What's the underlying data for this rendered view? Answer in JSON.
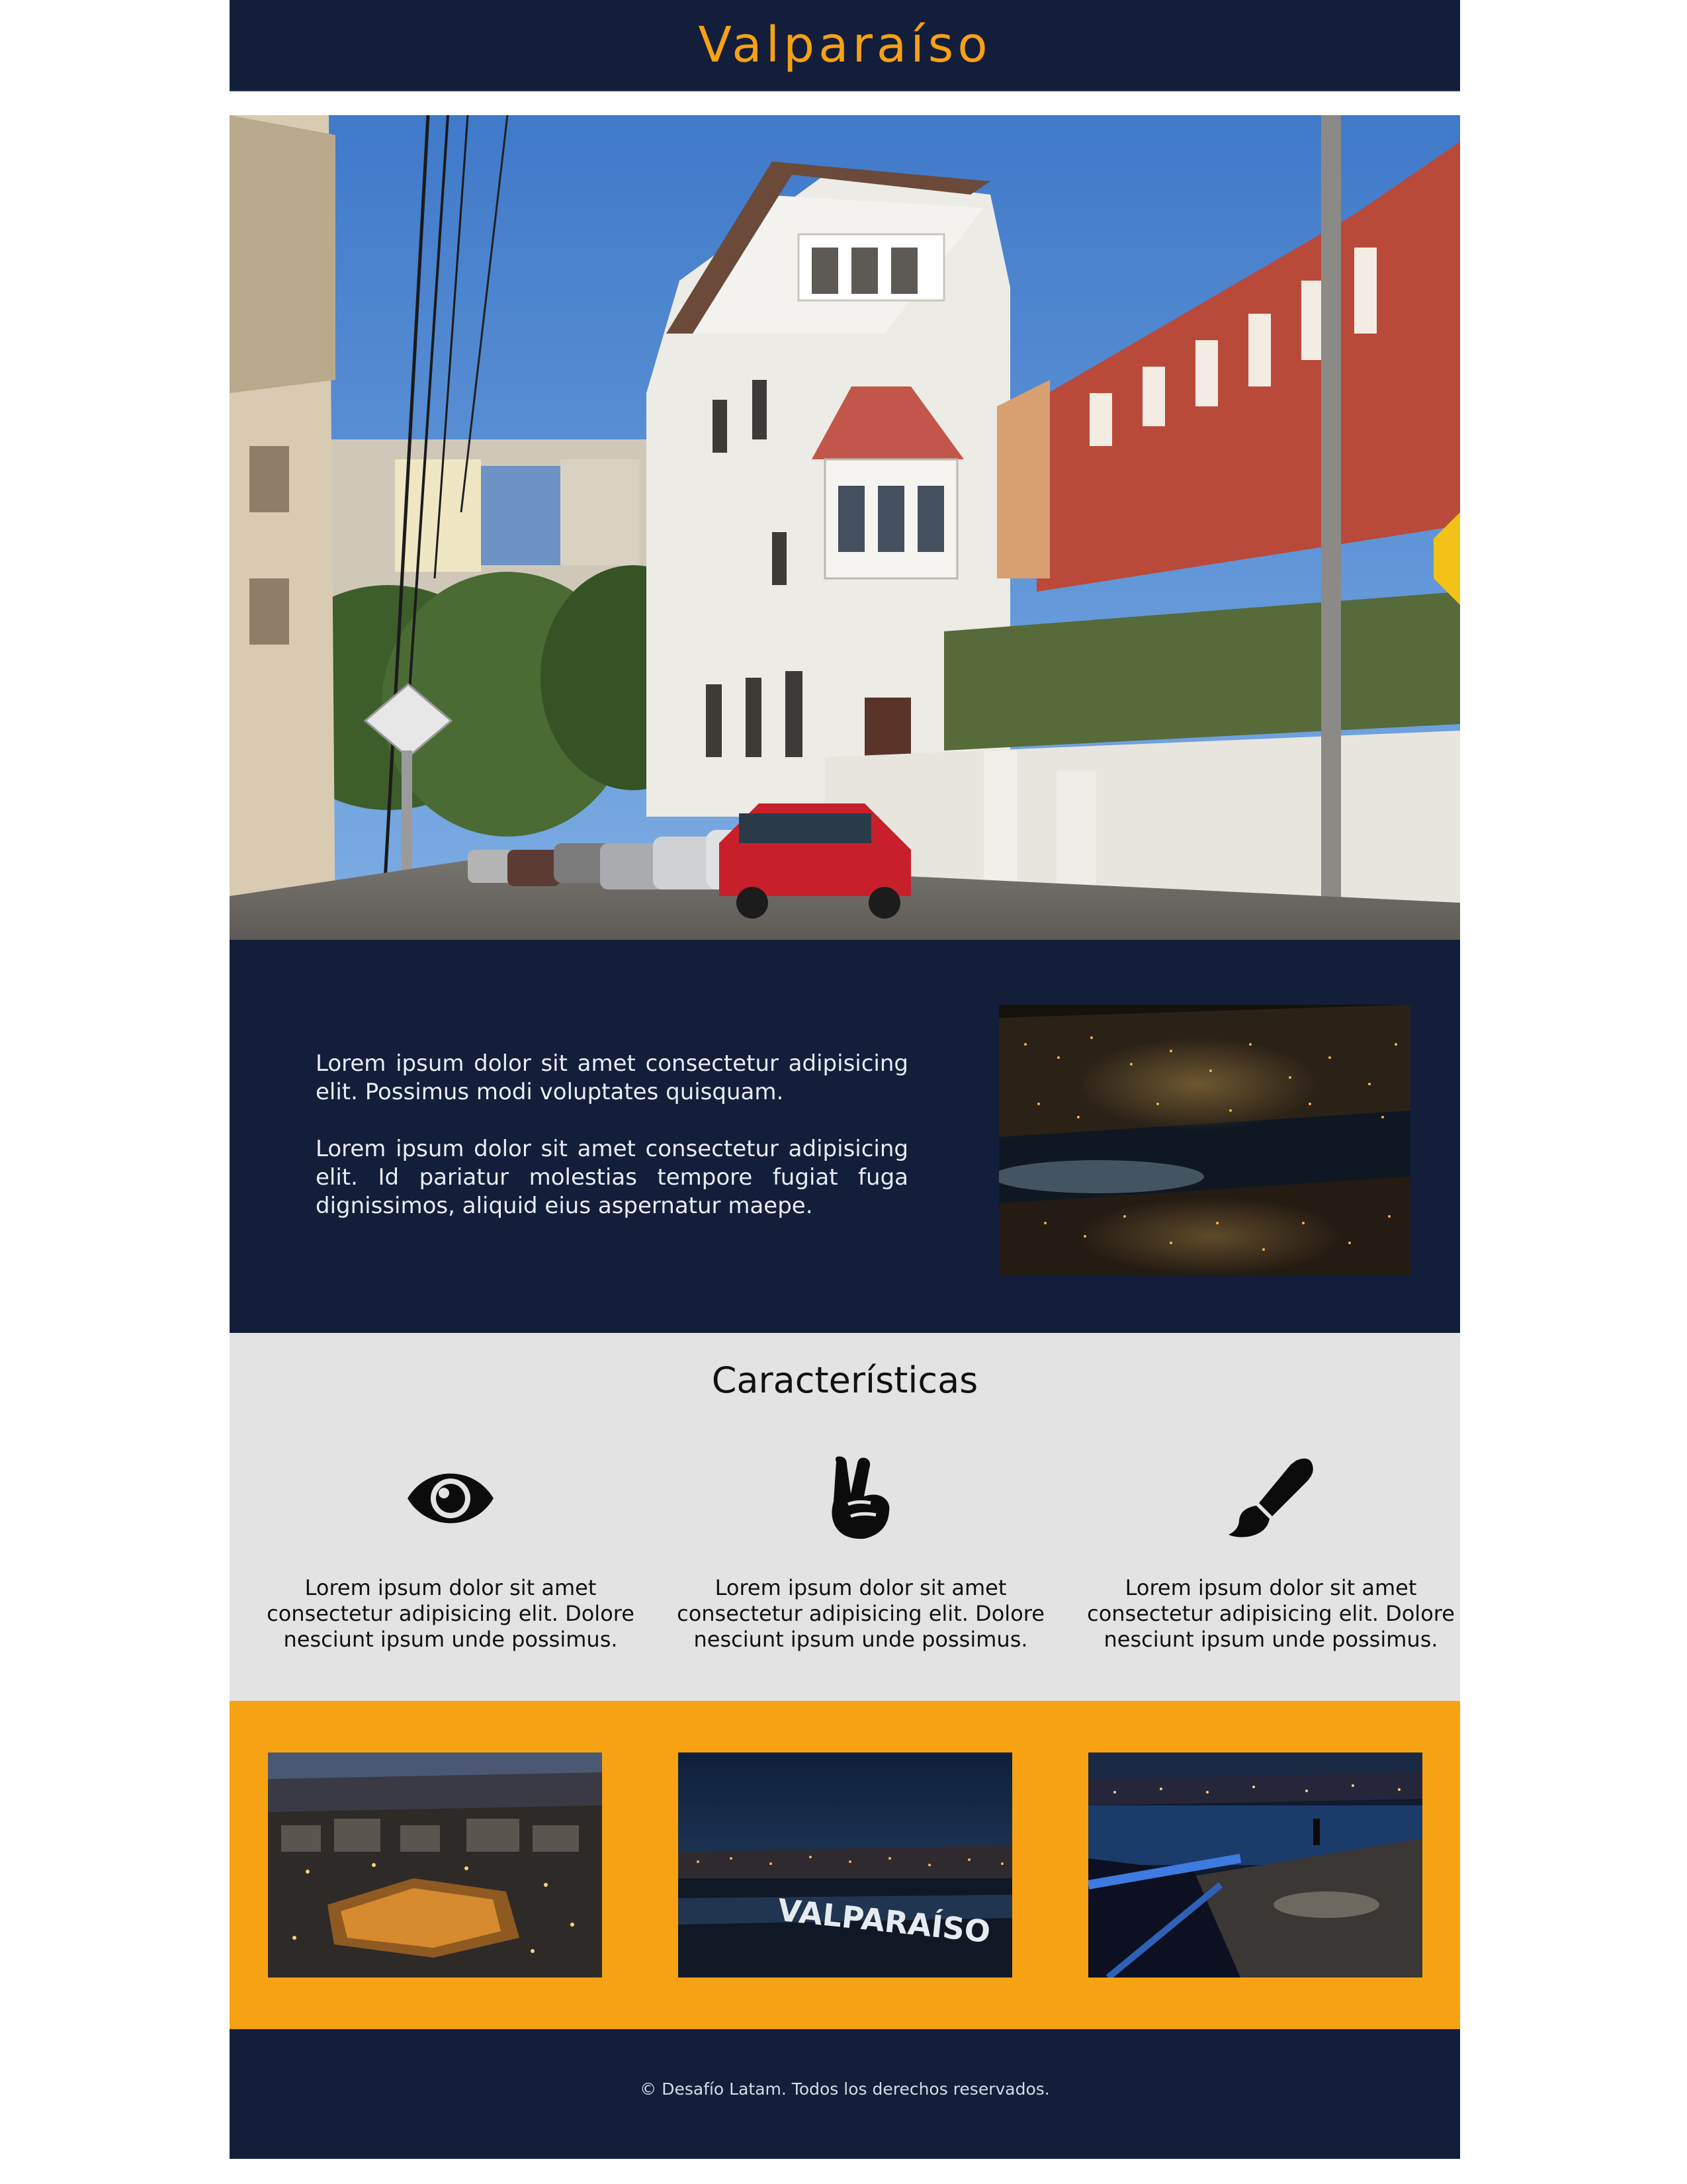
{
  "header": {
    "title": "Valparaíso",
    "title_color": "#f7a114",
    "background": "#131e3b"
  },
  "hero": {
    "image_icon": "street-photo-icon"
  },
  "intro": {
    "paragraphs": [
      "Lorem ipsum dolor sit amet consectetur adipisicing elit. Possimus modi voluptates quisquam.",
      "Lorem ipsum dolor sit amet consectetur adipisicing elit. Id pariatur molestias tempore fugiat fuga dignissimos, aliquid eius aspernatur maepe."
    ],
    "photo_icon": "night-bay-photo-icon"
  },
  "features": {
    "title": "Características",
    "background": "#e3e3e3",
    "items": [
      {
        "icon": "eye-icon",
        "text": "Lorem ipsum dolor sit amet consectetur adipisicing elit. Dolore nesciunt ipsum unde possimus."
      },
      {
        "icon": "peace-hand-icon",
        "text": "Lorem ipsum dolor sit amet consectetur adipisicing elit. Dolore nesciunt ipsum unde possimus."
      },
      {
        "icon": "paint-brush-icon",
        "text": "Lorem ipsum dolor sit amet consectetur adipisicing elit. Dolore nesciunt ipsum unde possimus."
      }
    ]
  },
  "gallery": {
    "background": "#f6a212",
    "images": [
      {
        "icon": "city-night-aerial-photo-icon"
      },
      {
        "icon": "valparaiso-sign-photo-icon",
        "sign_text": "VALPARAÍSO"
      },
      {
        "icon": "waterfront-night-photo-icon"
      }
    ]
  },
  "footer": {
    "text": "© Desafío Latam. Todos los derechos reservados."
  }
}
